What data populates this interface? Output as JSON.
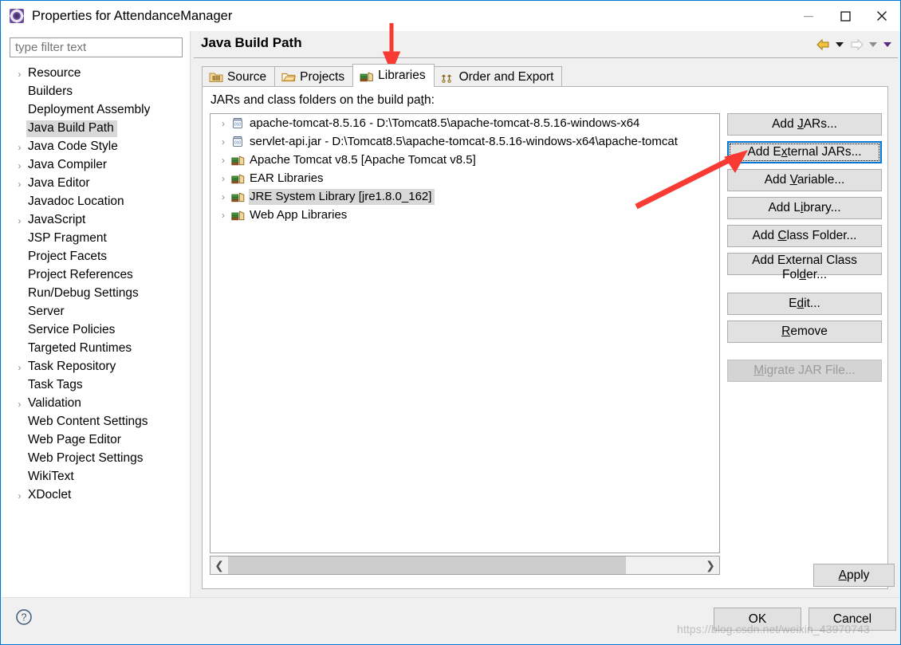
{
  "window": {
    "title": "Properties for AttendanceManager",
    "icon": "properties-gear-icon",
    "minimize_label": "Minimize",
    "maximize_label": "Maximize",
    "close_label": "Close"
  },
  "sidebar": {
    "filter": {
      "placeholder": "type filter text",
      "value": ""
    },
    "items": [
      {
        "label": "Resource",
        "expandable": true,
        "selected": false
      },
      {
        "label": "Builders",
        "expandable": false,
        "selected": false
      },
      {
        "label": "Deployment Assembly",
        "expandable": false,
        "selected": false
      },
      {
        "label": "Java Build Path",
        "expandable": false,
        "selected": true
      },
      {
        "label": "Java Code Style",
        "expandable": true,
        "selected": false
      },
      {
        "label": "Java Compiler",
        "expandable": true,
        "selected": false
      },
      {
        "label": "Java Editor",
        "expandable": true,
        "selected": false
      },
      {
        "label": "Javadoc Location",
        "expandable": false,
        "selected": false
      },
      {
        "label": "JavaScript",
        "expandable": true,
        "selected": false
      },
      {
        "label": "JSP Fragment",
        "expandable": false,
        "selected": false
      },
      {
        "label": "Project Facets",
        "expandable": false,
        "selected": false
      },
      {
        "label": "Project References",
        "expandable": false,
        "selected": false
      },
      {
        "label": "Run/Debug Settings",
        "expandable": false,
        "selected": false
      },
      {
        "label": "Server",
        "expandable": false,
        "selected": false
      },
      {
        "label": "Service Policies",
        "expandable": false,
        "selected": false
      },
      {
        "label": "Targeted Runtimes",
        "expandable": false,
        "selected": false
      },
      {
        "label": "Task Repository",
        "expandable": true,
        "selected": false
      },
      {
        "label": "Task Tags",
        "expandable": false,
        "selected": false
      },
      {
        "label": "Validation",
        "expandable": true,
        "selected": false
      },
      {
        "label": "Web Content Settings",
        "expandable": false,
        "selected": false
      },
      {
        "label": "Web Page Editor",
        "expandable": false,
        "selected": false
      },
      {
        "label": "Web Project Settings",
        "expandable": false,
        "selected": false
      },
      {
        "label": "WikiText",
        "expandable": false,
        "selected": false
      },
      {
        "label": "XDoclet",
        "expandable": true,
        "selected": false
      }
    ]
  },
  "page": {
    "title": "Java Build Path",
    "nav": {
      "back_icon": "back-arrow-icon",
      "back_dropdown_icon": "chevron-down-icon",
      "forward_icon": "forward-arrow-icon",
      "forward_dropdown_icon": "chevron-down-icon",
      "menu_dropdown_icon": "chevron-down-icon"
    },
    "tabs": [
      {
        "label": "Source",
        "icon": "source-folder-icon",
        "active": false
      },
      {
        "label": "Projects",
        "icon": "projects-folder-icon",
        "active": false
      },
      {
        "label": "Libraries",
        "icon": "libraries-books-icon",
        "active": true
      },
      {
        "label": "Order and Export",
        "icon": "order-export-icon",
        "active": false
      }
    ],
    "list_caption_before": "JARs and class folders on the build pa",
    "list_caption_mnemonic": "t",
    "list_caption_after": "h:",
    "entries": [
      {
        "label": "apache-tomcat-8.5.16 - D:\\Tomcat8.5\\apache-tomcat-8.5.16-windows-x64",
        "icon": "jar-icon",
        "selected": false
      },
      {
        "label": "servlet-api.jar - D:\\Tomcat8.5\\apache-tomcat-8.5.16-windows-x64\\apache-tomcat",
        "icon": "jar-icon",
        "selected": false
      },
      {
        "label": "Apache Tomcat v8.5 [Apache Tomcat v8.5]",
        "icon": "library-icon",
        "selected": false
      },
      {
        "label": "EAR Libraries",
        "icon": "library-icon",
        "selected": false
      },
      {
        "label": "JRE System Library [jre1.8.0_162]",
        "icon": "library-icon",
        "selected": true
      },
      {
        "label": "Web App Libraries",
        "icon": "library-icon",
        "selected": false
      }
    ],
    "scrollbar": {
      "left_icon": "chevron-left-icon",
      "right_icon": "chevron-right-icon",
      "thumb_position_percent": 0
    },
    "buttons": [
      {
        "id": "add-jars",
        "before": "Add ",
        "mnemonic": "J",
        "after": "ARs...",
        "state": "normal"
      },
      {
        "id": "add-external-jars",
        "before": "Add E",
        "mnemonic": "x",
        "after": "ternal JARs...",
        "state": "focused"
      },
      {
        "id": "add-variable",
        "before": "Add ",
        "mnemonic": "V",
        "after": "ariable...",
        "state": "normal"
      },
      {
        "id": "add-library",
        "before": "Add L",
        "mnemonic": "i",
        "after": "brary...",
        "state": "normal"
      },
      {
        "id": "add-class-folder",
        "before": "Add ",
        "mnemonic": "C",
        "after": "lass Folder...",
        "state": "normal"
      },
      {
        "id": "add-external-class-folder",
        "before": "Add External Class Fol",
        "mnemonic": "d",
        "after": "er...",
        "state": "normal"
      },
      {
        "id": "edit",
        "before": "E",
        "mnemonic": "d",
        "after": "it...",
        "state": "normal"
      },
      {
        "id": "remove",
        "before": "",
        "mnemonic": "R",
        "after": "emove",
        "state": "normal"
      },
      {
        "id": "migrate-jar-file",
        "before": "",
        "mnemonic": "M",
        "after": "igrate JAR File...",
        "state": "disabled"
      }
    ]
  },
  "footer": {
    "apply": {
      "before": "",
      "mnemonic": "A",
      "after": "pply"
    },
    "help_icon": "help-question-icon",
    "ok_label": "OK",
    "cancel_label": "Cancel"
  },
  "watermark": "https://blog.csdn.net/weixin_43970743",
  "annotations": [
    {
      "name": "arrow-to-libraries-tab",
      "color": "#f93a33"
    },
    {
      "name": "arrow-to-add-external-jars",
      "color": "#f93a33"
    }
  ],
  "colors": {
    "accent": "#0078d7",
    "selection": "#d8d8d8",
    "button_face": "#e1e1e1",
    "annotation_red": "#f93a33"
  }
}
